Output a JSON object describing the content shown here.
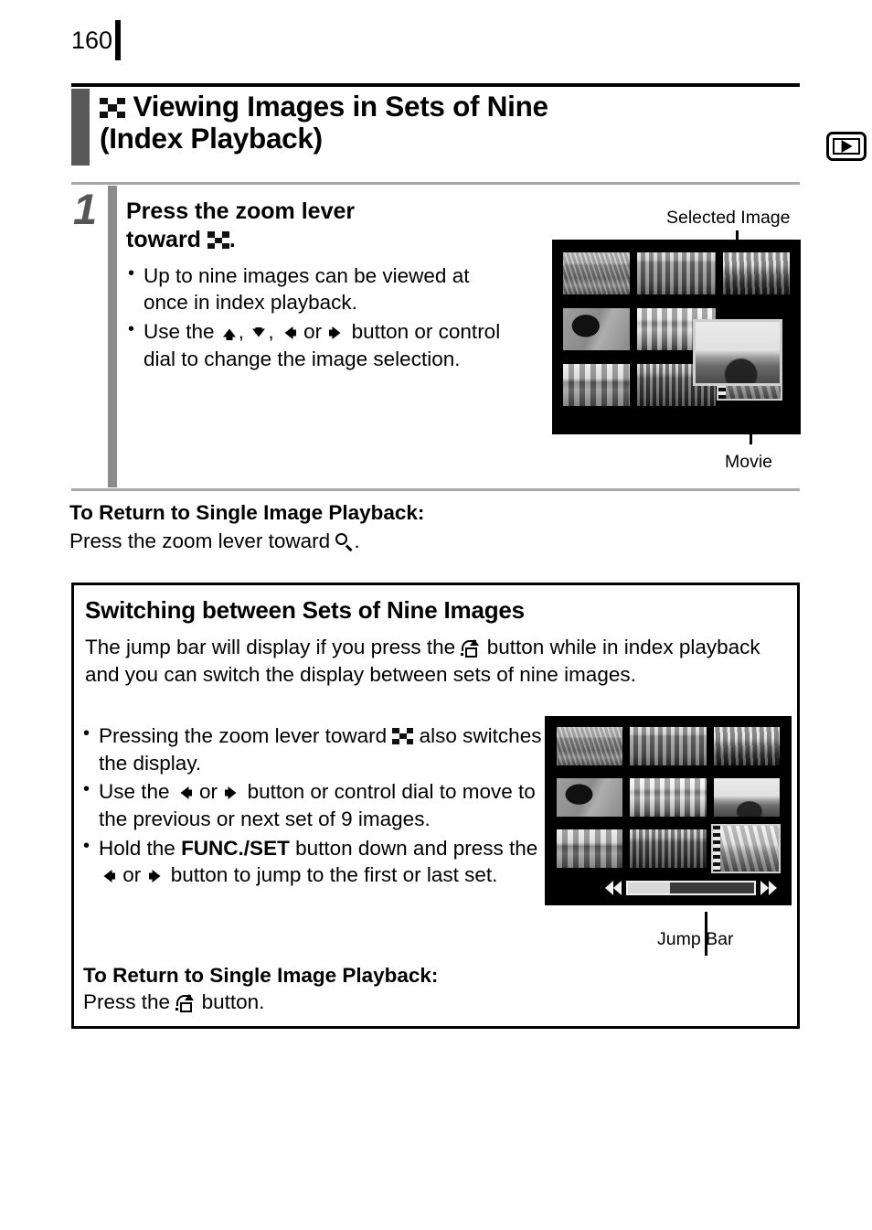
{
  "page": {
    "number": "160"
  },
  "section": {
    "icon": "index-checkerboard-icon",
    "title_line1": "Viewing Images in Sets of Nine",
    "title_line2": "(Index Playback)",
    "mode_icon": "playback-mode-icon"
  },
  "step1": {
    "number": "1",
    "title_prefix": "Press the zoom lever",
    "title_suffix": "toward",
    "title_icon": "index-checkerboard-icon",
    "title_period": ".",
    "bullets": [
      {
        "id": "bullet-nine-images",
        "parts": [
          {
            "type": "text",
            "value": "Up to nine images can be viewed at once in index playback."
          }
        ]
      },
      {
        "id": "bullet-use-buttons",
        "parts": [
          {
            "type": "text",
            "value": "Use the "
          },
          {
            "type": "icon",
            "value": "arrow-up-icon"
          },
          {
            "type": "text",
            "value": ", "
          },
          {
            "type": "icon",
            "value": "arrow-down-icon"
          },
          {
            "type": "text",
            "value": ", "
          },
          {
            "type": "icon",
            "value": "arrow-left-icon"
          },
          {
            "type": "text",
            "value": " or "
          },
          {
            "type": "icon",
            "value": "arrow-right-icon"
          },
          {
            "type": "text",
            "value": " button or control dial to change the image selection."
          }
        ]
      }
    ],
    "screen": {
      "callout_selected": "Selected Image",
      "callout_movie": "Movie",
      "thumbnails": [
        "aerial-city-photo",
        "ornate-building-photo",
        "cathedral-photo",
        "bird-photo",
        "colonnade-hall-photo",
        "harbour-bridge-photo",
        "riverside-skyline-photo",
        "downtown-towers-photo",
        "movie-clip-thumbnail"
      ],
      "selected_index": 5,
      "movie_index": 8
    }
  },
  "return_single": {
    "title": "To Return to Single Image Playback:",
    "instruction_prefix": "Press the zoom lever toward",
    "instruction_icon": "magnifier-zoom-icon",
    "instruction_suffix": "."
  },
  "switching_box": {
    "title": "Switching between Sets of Nine Images",
    "paragraph": [
      {
        "type": "text",
        "value": "The jump bar will display if you press the "
      },
      {
        "type": "icon",
        "value": "jump-button-icon"
      },
      {
        "type": "text",
        "value": " button while in index playback and you can switch the display between sets of nine images."
      }
    ],
    "bullets": [
      {
        "id": "bullet-zoom-lever-switch",
        "parts": [
          {
            "type": "text",
            "value": "Pressing the zoom lever toward "
          },
          {
            "type": "icon",
            "value": "index-checkerboard-icon"
          },
          {
            "type": "text",
            "value": " also switches the display."
          }
        ]
      },
      {
        "id": "bullet-prev-next-set",
        "parts": [
          {
            "type": "text",
            "value": "Use the "
          },
          {
            "type": "icon",
            "value": "arrow-left-icon"
          },
          {
            "type": "text",
            "value": " or "
          },
          {
            "type": "icon",
            "value": "arrow-right-icon"
          },
          {
            "type": "text",
            "value": " button or control dial to move to the previous or next set of 9 images."
          }
        ]
      },
      {
        "id": "bullet-func-set-jump",
        "parts": [
          {
            "type": "text",
            "value": "Hold the "
          },
          {
            "type": "bold",
            "value": "FUNC./SET"
          },
          {
            "type": "text",
            "value": " button down and press the "
          },
          {
            "type": "icon",
            "value": "arrow-left-icon"
          },
          {
            "type": "text",
            "value": " or "
          },
          {
            "type": "icon",
            "value": "arrow-right-icon"
          },
          {
            "type": "text",
            "value": " button to jump to the first or last set."
          }
        ]
      }
    ],
    "return_title": "To Return to Single Image Playback:",
    "return_prefix": "Press the",
    "return_icon": "jump-button-icon",
    "return_suffix": "button.",
    "screen": {
      "callout_jumpbar": "Jump Bar",
      "thumbnails": [
        "aerial-city-photo",
        "ornate-building-photo",
        "cathedral-photo",
        "bird-photo",
        "colonnade-hall-photo",
        "harbour-bridge-photo",
        "riverside-skyline-photo",
        "downtown-towers-photo",
        "movie-clip-thumbnail"
      ],
      "movie_index": 8,
      "jump_bar": {
        "fill_percent": 33,
        "left_icon": "double-arrow-left-icon",
        "right_icon": "double-arrow-right-icon"
      }
    }
  },
  "colors": {
    "header_bar": "#595959",
    "step_bar": "#8c8c8c",
    "rule_light": "#a8a8a8",
    "text": "#000000",
    "lcd_background": "#000000"
  }
}
